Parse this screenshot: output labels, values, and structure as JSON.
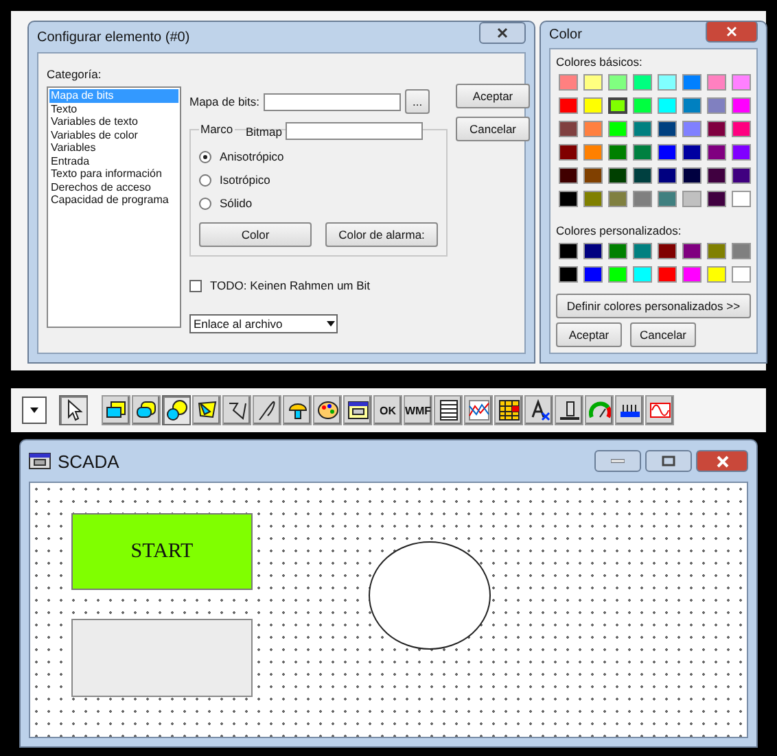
{
  "config_dialog": {
    "title": "Configurar elemento (#0)",
    "category_label": "Categoría:",
    "categories": [
      {
        "label": "Mapa de bits",
        "selected": true
      },
      {
        "label": "Texto",
        "selected": false
      },
      {
        "label": "Variables de texto",
        "selected": false
      },
      {
        "label": "Variables de color",
        "selected": false
      },
      {
        "label": "Variables",
        "selected": false
      },
      {
        "label": "Entrada",
        "selected": false
      },
      {
        "label": "Texto para información",
        "selected": false
      },
      {
        "label": "Derechos de acceso",
        "selected": false
      },
      {
        "label": "Capacidad de programa",
        "selected": false
      }
    ],
    "bitmap_label": "Mapa de bits:",
    "browse_button": "...",
    "frame_group": "Marco",
    "frame_field_label": "Bitmap",
    "radios": [
      {
        "label": "Anisotrópico",
        "selected": true
      },
      {
        "label": "Isotrópico",
        "selected": false
      },
      {
        "label": "Sólido",
        "selected": false
      }
    ],
    "color_buttons": [
      "Color",
      "Color de alarma:"
    ],
    "checkbox": {
      "label": "TODO: Keinen Rahmen um Bit",
      "checked": false
    },
    "link_select": "Enlace al archivo",
    "buttons": [
      "Aceptar",
      "Cancelar"
    ]
  },
  "color_dialog": {
    "title": "Color",
    "basic_label": "Colores básicos:",
    "basic_colors": [
      {
        "color": "#ff8080",
        "selected": false
      },
      {
        "color": "#ffff80",
        "selected": false
      },
      {
        "color": "#80ff80",
        "selected": false
      },
      {
        "color": "#00ff80",
        "selected": false
      },
      {
        "color": "#80ffff",
        "selected": false
      },
      {
        "color": "#0080ff",
        "selected": false
      },
      {
        "color": "#ff80c0",
        "selected": false
      },
      {
        "color": "#ff80ff",
        "selected": false
      },
      {
        "color": "#ff0000",
        "selected": false
      },
      {
        "color": "#ffff00",
        "selected": false
      },
      {
        "color": "#80ff00",
        "selected": true
      },
      {
        "color": "#00ff40",
        "selected": false
      },
      {
        "color": "#00ffff",
        "selected": false
      },
      {
        "color": "#0080c0",
        "selected": false
      },
      {
        "color": "#8080c0",
        "selected": false
      },
      {
        "color": "#ff00ff",
        "selected": false
      },
      {
        "color": "#804040",
        "selected": false
      },
      {
        "color": "#ff8040",
        "selected": false
      },
      {
        "color": "#00ff00",
        "selected": false
      },
      {
        "color": "#008080",
        "selected": false
      },
      {
        "color": "#004080",
        "selected": false
      },
      {
        "color": "#8080ff",
        "selected": false
      },
      {
        "color": "#800040",
        "selected": false
      },
      {
        "color": "#ff0080",
        "selected": false
      },
      {
        "color": "#800000",
        "selected": false
      },
      {
        "color": "#ff8000",
        "selected": false
      },
      {
        "color": "#008000",
        "selected": false
      },
      {
        "color": "#008040",
        "selected": false
      },
      {
        "color": "#0000ff",
        "selected": false
      },
      {
        "color": "#0000a0",
        "selected": false
      },
      {
        "color": "#800080",
        "selected": false
      },
      {
        "color": "#8000ff",
        "selected": false
      },
      {
        "color": "#400000",
        "selected": false
      },
      {
        "color": "#804000",
        "selected": false
      },
      {
        "color": "#004000",
        "selected": false
      },
      {
        "color": "#004040",
        "selected": false
      },
      {
        "color": "#000080",
        "selected": false
      },
      {
        "color": "#000040",
        "selected": false
      },
      {
        "color": "#400040",
        "selected": false
      },
      {
        "color": "#400080",
        "selected": false
      },
      {
        "color": "#000000",
        "selected": false
      },
      {
        "color": "#808000",
        "selected": false
      },
      {
        "color": "#808040",
        "selected": false
      },
      {
        "color": "#808080",
        "selected": false
      },
      {
        "color": "#408080",
        "selected": false
      },
      {
        "color": "#c0c0c0",
        "selected": false
      },
      {
        "color": "#400040",
        "selected": false
      },
      {
        "color": "#ffffff",
        "selected": false
      }
    ],
    "custom_label": "Colores personalizados:",
    "custom_colors": [
      {
        "color": "#000000"
      },
      {
        "color": "#000080"
      },
      {
        "color": "#008000"
      },
      {
        "color": "#008080"
      },
      {
        "color": "#800000"
      },
      {
        "color": "#800080"
      },
      {
        "color": "#808000"
      },
      {
        "color": "#808080"
      },
      {
        "color": "#000000"
      },
      {
        "color": "#0000ff"
      },
      {
        "color": "#00ff00"
      },
      {
        "color": "#00ffff"
      },
      {
        "color": "#ff0000"
      },
      {
        "color": "#ff00ff"
      },
      {
        "color": "#ffff00"
      },
      {
        "color": "#ffffff"
      }
    ],
    "define_button": "Definir colores personalizados >>",
    "buttons": [
      "Aceptar",
      "Cancelar"
    ]
  },
  "toolbar": {
    "tools": [
      {
        "kind": "pointer",
        "selected": true
      },
      {
        "kind": "rect",
        "selected": false
      },
      {
        "kind": "rounded",
        "selected": false
      },
      {
        "kind": "ellipse",
        "selected": true
      },
      {
        "kind": "polygon",
        "selected": false
      },
      {
        "kind": "polyline",
        "selected": false
      },
      {
        "kind": "curve",
        "selected": false
      },
      {
        "kind": "stamp",
        "selected": false
      },
      {
        "kind": "palette",
        "selected": false
      },
      {
        "kind": "window",
        "selected": false
      },
      {
        "kind": "label",
        "text": "OK",
        "selected": false
      },
      {
        "kind": "label",
        "text": "WMF",
        "selected": false
      },
      {
        "kind": "list",
        "selected": false
      },
      {
        "kind": "trend",
        "selected": false
      },
      {
        "kind": "table",
        "selected": false
      },
      {
        "kind": "font",
        "selected": false
      },
      {
        "kind": "slider",
        "selected": false
      },
      {
        "kind": "gauge",
        "selected": false
      },
      {
        "kind": "bars",
        "selected": false
      },
      {
        "kind": "wave",
        "selected": false
      }
    ]
  },
  "scada_window": {
    "title": "SCADA",
    "start_button": "START"
  }
}
